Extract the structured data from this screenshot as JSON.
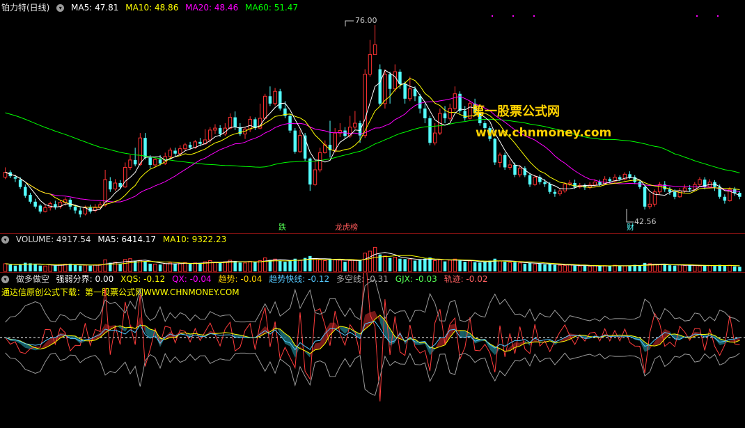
{
  "main": {
    "title": "铂力特(日线)",
    "ma5_label": "MA5: 47.81",
    "ma10_label": "MA10: 48.86",
    "ma20_label": "MA20: 48.46",
    "ma60_label": "MA60: 51.47",
    "high_label": "76.00",
    "low_label": "42.56",
    "tags": [
      "跌",
      "龙虎榜",
      "财"
    ],
    "watermark_cn": "第一股票公式网",
    "watermark_url": "www.chnmoney.com"
  },
  "volume": {
    "vol_label": "VOLUME: 4917.54",
    "ma5_label": "MA5: 6414.17",
    "ma10_label": "MA10: 9322.23"
  },
  "indicator": {
    "name": "做多做空",
    "items": [
      "强弱分界: 0.00",
      "XQS: -0.12",
      "QX: -0.04",
      "趋势: -0.04",
      "趋势快线: -0.12",
      "多空线: -0.31",
      "GJX: -0.03",
      "轨迹: -0.02"
    ],
    "source_text": "通达信原创公式下载：第一股票公式网WWW.CHNMONEY.COM"
  },
  "colors": {
    "up": "#ff3232",
    "down": "#54ffff",
    "ma5": "#ffffff",
    "ma10": "#ffff00",
    "ma20": "#ff00ff",
    "ma60": "#00ff00",
    "grid": "#7a1010"
  },
  "candles": [
    [
      45.0,
      46.0,
      47.0,
      44.6
    ],
    [
      46.0,
      45.2,
      46.4,
      44.8
    ],
    [
      45.0,
      44.7,
      45.5,
      44.0
    ],
    [
      44.5,
      43.0,
      45.0,
      42.6
    ],
    [
      43.0,
      41.2,
      43.5,
      40.8
    ],
    [
      41.4,
      40.0,
      41.8,
      39.6
    ],
    [
      40.0,
      39.0,
      40.6,
      38.6
    ],
    [
      39.2,
      38.0,
      39.5,
      37.6
    ],
    [
      38.0,
      38.8,
      39.4,
      37.8
    ],
    [
      38.8,
      39.6,
      40.0,
      38.2
    ],
    [
      39.5,
      38.9,
      40.2,
      38.4
    ],
    [
      39.0,
      39.9,
      40.4,
      38.6
    ],
    [
      39.8,
      40.4,
      40.9,
      39.2
    ],
    [
      40.4,
      39.0,
      40.8,
      38.4
    ],
    [
      39.0,
      38.2,
      39.4,
      37.6
    ],
    [
      38.2,
      37.4,
      38.8,
      36.8
    ],
    [
      37.5,
      38.8,
      39.2,
      37.2
    ],
    [
      38.8,
      38.0,
      39.4,
      37.6
    ],
    [
      38.2,
      38.8,
      39.5,
      37.8
    ],
    [
      38.8,
      39.4,
      40.0,
      38.4
    ],
    [
      39.3,
      44.5,
      46.5,
      39.0
    ],
    [
      44.2,
      42.5,
      45.0,
      42.0
    ],
    [
      42.6,
      43.8,
      44.6,
      42.2
    ],
    [
      43.8,
      43.0,
      44.4,
      42.5
    ],
    [
      43.0,
      47.0,
      48.0,
      42.8
    ],
    [
      47.0,
      48.5,
      49.5,
      46.5
    ],
    [
      48.5,
      47.6,
      51.0,
      47.2
    ],
    [
      47.6,
      53.0,
      54.0,
      47.3
    ],
    [
      53.0,
      49.0,
      54.0,
      48.6
    ],
    [
      49.0,
      47.5,
      49.5,
      46.8
    ],
    [
      47.5,
      48.6,
      49.0,
      47.0
    ],
    [
      48.6,
      47.8,
      49.5,
      47.4
    ],
    [
      47.8,
      49.2,
      50.0,
      47.5
    ],
    [
      49.2,
      50.5,
      51.0,
      48.8
    ],
    [
      50.4,
      49.8,
      51.0,
      49.3
    ],
    [
      49.8,
      50.8,
      51.5,
      49.4
    ],
    [
      50.8,
      51.6,
      52.0,
      50.4
    ],
    [
      51.6,
      51.0,
      52.2,
      50.6
    ],
    [
      51.0,
      52.2,
      52.6,
      50.8
    ],
    [
      52.2,
      51.8,
      53.0,
      51.3
    ],
    [
      51.8,
      52.6,
      54.8,
      51.6
    ],
    [
      52.6,
      54.6,
      55.2,
      52.0
    ],
    [
      54.6,
      55.0,
      55.8,
      53.8
    ],
    [
      55.0,
      53.8,
      55.6,
      53.2
    ],
    [
      53.8,
      55.0,
      56.0,
      53.4
    ],
    [
      55.0,
      57.2,
      58.0,
      54.8
    ],
    [
      57.2,
      55.2,
      58.4,
      54.6
    ],
    [
      55.2,
      53.8,
      56.0,
      53.4
    ],
    [
      53.8,
      54.8,
      55.2,
      52.8
    ],
    [
      54.8,
      56.8,
      57.4,
      54.2
    ],
    [
      56.8,
      55.0,
      57.2,
      54.6
    ],
    [
      55.0,
      57.0,
      60.0,
      54.8
    ],
    [
      57.0,
      61.5,
      62.0,
      56.8
    ],
    [
      61.5,
      60.0,
      63.5,
      59.5
    ],
    [
      60.0,
      62.5,
      63.2,
      59.6
    ],
    [
      62.5,
      59.0,
      63.0,
      58.6
    ],
    [
      59.0,
      57.5,
      60.5,
      57.0
    ],
    [
      57.5,
      54.5,
      58.0,
      54.0
    ],
    [
      54.5,
      50.2,
      55.0,
      49.8
    ],
    [
      50.2,
      53.5,
      54.6,
      50.0
    ],
    [
      53.5,
      48.8,
      54.0,
      48.2
    ],
    [
      48.8,
      43.5,
      49.0,
      42.2
    ],
    [
      43.5,
      46.5,
      48.5,
      43.2
    ],
    [
      46.5,
      50.0,
      51.0,
      46.0
    ],
    [
      50.0,
      51.6,
      52.5,
      49.8
    ],
    [
      51.6,
      50.5,
      56.5,
      49.0
    ],
    [
      50.5,
      54.0,
      55.0,
      50.0
    ],
    [
      54.0,
      54.5,
      56.0,
      53.2
    ],
    [
      54.5,
      53.4,
      55.2,
      52.8
    ],
    [
      53.4,
      55.2,
      57.5,
      53.0
    ],
    [
      55.2,
      56.0,
      58.5,
      54.8
    ],
    [
      56.0,
      53.5,
      56.5,
      52.0
    ],
    [
      53.5,
      66.0,
      67.0,
      53.0
    ],
    [
      66.0,
      70.0,
      73.0,
      65.5
    ],
    [
      70.0,
      72.0,
      76.0,
      70.0
    ],
    [
      67.0,
      60.0,
      68.0,
      59.6
    ],
    [
      60.0,
      66.0,
      67.0,
      59.0
    ],
    [
      66.0,
      63.0,
      66.5,
      60.0
    ],
    [
      63.0,
      66.5,
      68.0,
      62.4
    ],
    [
      66.5,
      64.0,
      67.0,
      63.0
    ],
    [
      64.0,
      61.0,
      64.5,
      60.0
    ],
    [
      61.0,
      63.0,
      65.5,
      60.5
    ],
    [
      63.0,
      61.5,
      63.5,
      60.5
    ],
    [
      61.5,
      59.0,
      62.0,
      58.0
    ],
    [
      59.0,
      57.0,
      60.0,
      56.0
    ],
    [
      57.0,
      52.0,
      57.5,
      51.5
    ],
    [
      52.0,
      54.0,
      56.0,
      51.5
    ],
    [
      54.0,
      58.0,
      59.0,
      53.6
    ],
    [
      58.0,
      57.0,
      59.5,
      56.0
    ],
    [
      57.0,
      59.0,
      60.0,
      56.5
    ],
    [
      59.0,
      62.0,
      63.5,
      58.5
    ],
    [
      62.0,
      58.5,
      62.5,
      58.0
    ],
    [
      58.5,
      57.0,
      59.5,
      56.5
    ],
    [
      57.0,
      60.0,
      60.5,
      56.8
    ],
    [
      60.0,
      58.0,
      61.0,
      57.5
    ],
    [
      58.0,
      56.0,
      58.5,
      55.5
    ],
    [
      56.0,
      55.0,
      56.5,
      54.5
    ],
    [
      55.0,
      52.8,
      55.4,
      52.3
    ],
    [
      52.8,
      48.0,
      53.0,
      47.5
    ],
    [
      48.0,
      49.5,
      50.0,
      47.0
    ],
    [
      49.5,
      47.0,
      50.0,
      46.5
    ],
    [
      47.0,
      47.5,
      48.5,
      46.5
    ],
    [
      47.5,
      45.5,
      48.0,
      45.0
    ],
    [
      45.5,
      46.8,
      47.5,
      45.0
    ],
    [
      46.8,
      45.4,
      47.2,
      45.0
    ],
    [
      45.4,
      43.5,
      45.8,
      43.0
    ],
    [
      43.5,
      45.0,
      45.5,
      43.2
    ],
    [
      45.0,
      44.0,
      45.5,
      43.5
    ],
    [
      44.0,
      43.6,
      44.6,
      43.0
    ],
    [
      43.6,
      42.0,
      44.0,
      41.6
    ],
    [
      42.0,
      41.6,
      42.5,
      41.0
    ],
    [
      41.6,
      42.2,
      42.8,
      41.2
    ],
    [
      42.2,
      43.6,
      44.0,
      41.8
    ],
    [
      43.6,
      43.8,
      44.4,
      43.2
    ],
    [
      43.8,
      43.0,
      44.5,
      42.6
    ],
    [
      43.0,
      43.3,
      43.8,
      42.7
    ],
    [
      43.3,
      42.9,
      43.7,
      42.4
    ],
    [
      42.9,
      43.4,
      44.0,
      42.5
    ],
    [
      43.4,
      44.0,
      44.6,
      43.0
    ],
    [
      44.0,
      43.6,
      44.5,
      43.2
    ],
    [
      43.6,
      44.6,
      45.2,
      43.4
    ],
    [
      44.6,
      44.2,
      45.0,
      43.8
    ],
    [
      44.2,
      45.0,
      45.6,
      43.9
    ],
    [
      45.0,
      44.6,
      45.4,
      44.2
    ],
    [
      44.6,
      45.6,
      46.0,
      44.3
    ],
    [
      45.6,
      45.0,
      46.2,
      44.6
    ],
    [
      45.0,
      44.0,
      45.4,
      43.6
    ],
    [
      44.0,
      43.0,
      44.4,
      42.6
    ],
    [
      43.0,
      39.0,
      43.4,
      38.4
    ],
    [
      39.0,
      39.5,
      41.8,
      38.5
    ],
    [
      39.5,
      42.0,
      42.5,
      39.0
    ],
    [
      42.0,
      43.5,
      44.0,
      41.5
    ],
    [
      43.5,
      42.5,
      44.2,
      42.0
    ],
    [
      42.5,
      42.0,
      43.0,
      41.4
    ],
    [
      42.0,
      41.0,
      42.5,
      40.5
    ],
    [
      41.0,
      42.2,
      42.8,
      40.8
    ],
    [
      42.2,
      42.8,
      43.5,
      41.8
    ],
    [
      42.8,
      42.5,
      43.4,
      42.0
    ],
    [
      42.5,
      43.5,
      44.0,
      42.1
    ],
    [
      43.5,
      44.5,
      45.0,
      43.0
    ],
    [
      44.5,
      43.0,
      45.0,
      42.5
    ],
    [
      43.0,
      44.0,
      44.6,
      42.7
    ],
    [
      44.0,
      43.0,
      44.4,
      42.2
    ],
    [
      43.0,
      41.0,
      43.5,
      40.6
    ],
    [
      41.0,
      40.2,
      41.5,
      39.6
    ],
    [
      40.2,
      42.5,
      43.0,
      40.0
    ],
    [
      42.5,
      41.8,
      43.0,
      41.2
    ],
    [
      41.8,
      41.0,
      42.2,
      40.5
    ]
  ],
  "volumes": [
    40,
    35,
    30,
    38,
    45,
    42,
    36,
    30,
    28,
    34,
    30,
    36,
    38,
    40,
    34,
    30,
    32,
    30,
    34,
    36,
    60,
    45,
    48,
    40,
    62,
    66,
    55,
    58,
    52,
    40,
    38,
    36,
    40,
    44,
    38,
    42,
    46,
    40,
    44,
    42,
    50,
    56,
    48,
    45,
    50,
    58,
    54,
    46,
    44,
    52,
    48,
    56,
    70,
    60,
    64,
    56,
    50,
    54,
    66,
    58,
    70,
    80,
    62,
    60,
    56,
    66,
    60,
    58,
    50,
    56,
    60,
    58,
    95,
    105,
    125,
    88,
    80,
    70,
    74,
    66,
    64,
    62,
    56,
    60,
    66,
    72,
    56,
    60,
    52,
    58,
    64,
    56,
    50,
    54,
    48,
    46,
    50,
    56,
    66,
    54,
    50,
    46,
    48,
    44,
    40,
    44,
    38,
    40,
    36,
    38,
    34,
    32,
    30,
    34,
    30,
    28,
    30,
    26,
    30,
    28,
    30,
    28,
    32,
    30,
    28,
    30,
    34,
    32,
    44,
    40,
    38,
    36,
    34,
    32,
    30,
    34,
    30,
    32,
    30,
    28,
    32,
    30,
    28,
    34,
    30,
    32,
    26,
    24
  ]
}
